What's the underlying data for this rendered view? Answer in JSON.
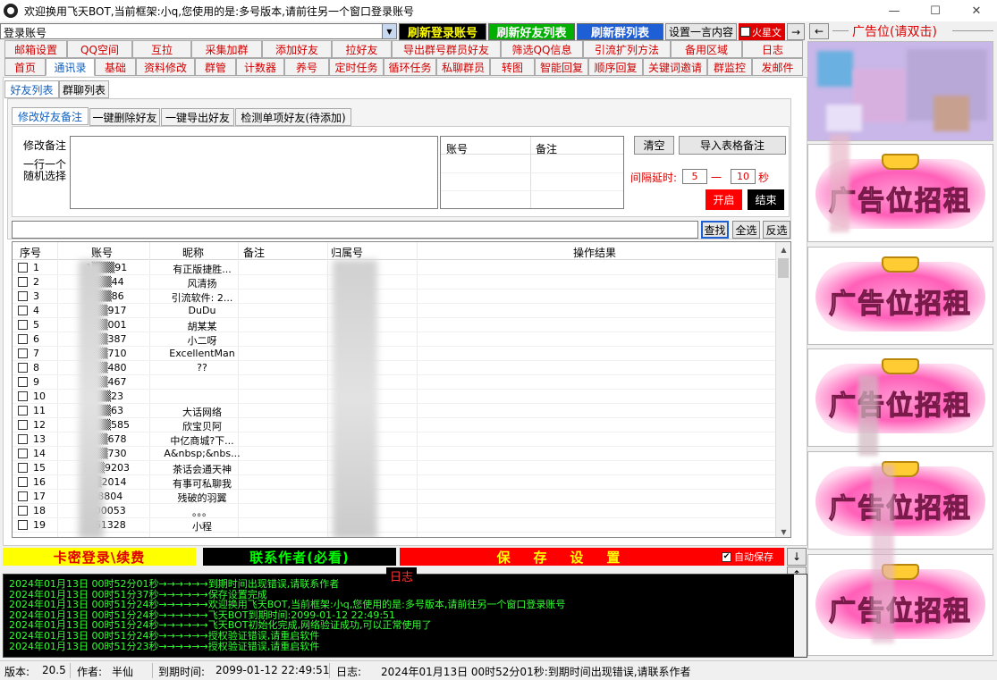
{
  "window": {
    "title": "欢迎换用飞天BOT,当前框架:小q,您使用的是:多号版本,请前往另一个窗口登录账号",
    "controls": [
      "—",
      "☐",
      "✕"
    ]
  },
  "toolbar": {
    "login_label": "登录账号",
    "refresh_login": "刷新登录账号",
    "refresh_friends": "刷新好友列表",
    "refresh_groups": "刷新群列表",
    "set_phrase": "设置一言内容",
    "huoxing": "火星文",
    "arrow_right": "→",
    "arrow_left": "←"
  },
  "menu_row1": [
    "邮箱设置",
    "QQ空间",
    "互拉",
    "采集加群",
    "添加好友",
    "拉好友",
    "导出群号群员好友",
    "筛选QQ信息",
    "引流扩列方法",
    "备用区域",
    "日志"
  ],
  "menu_row2": [
    "首页",
    "通讯录",
    "基础",
    "资料修改",
    "群管",
    "计数器",
    "养号",
    "定时任务",
    "循环任务",
    "私聊群员",
    "转图",
    "智能回复",
    "顺序回复",
    "关键词邀请",
    "群监控",
    "发邮件"
  ],
  "list_tabs": [
    "好友列表",
    "群聊列表"
  ],
  "action_tabs": [
    "修改好友备注",
    "一键删除好友",
    "一键导出好友",
    "检测单项好友(待添加)"
  ],
  "edit": {
    "modify_label": "修改备注",
    "hint_line1": "一行一个",
    "hint_line2": "随机选择",
    "table_head_account": "账号",
    "table_head_note": "备注",
    "clear": "清空",
    "import": "导入表格备注",
    "interval_label": "间隔延时:",
    "interval_from": "5",
    "interval_dash": "一",
    "interval_to": "10",
    "interval_unit": "秒",
    "start": "开启",
    "stop": "结束"
  },
  "search": {
    "value": "",
    "find": "查找",
    "select_all": "全选",
    "invert": "反选"
  },
  "grid": {
    "columns": [
      "序号",
      "账号",
      "昵称",
      "备注",
      "归属号",
      "操作结果"
    ],
    "rows": [
      {
        "seq": "1",
        "account": "1▒▒▒91",
        "nick": "有正版捷胜..."
      },
      {
        "seq": "2",
        "account": "▒▒▒44",
        "nick": "风清扬"
      },
      {
        "seq": "3",
        "account": "▒▒▒86",
        "nick": "引流软件: 2..."
      },
      {
        "seq": "4",
        "account": "2▒▒917",
        "nick": "DuDu"
      },
      {
        "seq": "5",
        "account": "4▒▒001",
        "nick": "胡某某"
      },
      {
        "seq": "6",
        "account": "4▒▒387",
        "nick": "小二呀"
      },
      {
        "seq": "7",
        "account": "5▒▒710",
        "nick": "ExcellentMan"
      },
      {
        "seq": "8",
        "account": "5▒▒480",
        "nick": "??"
      },
      {
        "seq": "9",
        "account": "9▒▒467",
        "nick": ""
      },
      {
        "seq": "10",
        "account": "9▒▒23",
        "nick": ""
      },
      {
        "seq": "11",
        "account": "9▒▒63",
        "nick": "大话网络"
      },
      {
        "seq": "12",
        "account": "14▒▒585",
        "nick": "欣宝贝阿"
      },
      {
        "seq": "13",
        "account": "2▒▒678",
        "nick": "中亿商城?下..."
      },
      {
        "seq": "14",
        "account": "3▒▒730",
        "nick": "A&nbsp;&nbs..."
      },
      {
        "seq": "15",
        "account": "3▒▒9203",
        "nick": "茶话会通天神"
      },
      {
        "seq": "16",
        "account": "▒▒2014",
        "nick": "有事可私聊我"
      },
      {
        "seq": "17",
        "account": "▒8804",
        "nick": "残破的羽翼"
      },
      {
        "seq": "18",
        "account": "▒00053",
        "nick": "。。。"
      },
      {
        "seq": "19",
        "account": "▒61328",
        "nick": "小程"
      }
    ]
  },
  "bottom_bar": {
    "card_login": "卡密登录\\续费",
    "contact": "联系作者(必看)",
    "save": "保    存    设    置",
    "auto_save": "自动保存",
    "down": "↓",
    "up": "↑"
  },
  "log": {
    "title": "日志",
    "lines": [
      "2024年01月13日  00时52分01秒→→→→→→到期时间出现错误,请联系作者",
      "2024年01月13日  00时51分37秒→→→→→→保存设置完成",
      "2024年01月13日  00时51分24秒→→→→→→欢迎换用飞天BOT,当前框架:小q,您使用的是:多号版本,请前往另一个窗口登录账号",
      "2024年01月13日  00时51分24秒→→→→→→飞天BOT到期时间:2099-01-12 22:49:51",
      "2024年01月13日  00时51分24秒→→→→→→飞天BOT初始化完成,网络验证成功,可以正常使用了",
      "2024年01月13日  00时51分24秒→→→→→→授权验证错误,请重启软件",
      "2024年01月13日  00时51分23秒→→→→→→授权验证错误,请重启软件"
    ]
  },
  "status": {
    "version_label": "版本:",
    "version": "20.5",
    "author_label": "作者:",
    "author": "半仙",
    "expiry_label": "到期时间:",
    "expiry": "2099-01-12 22:49:51",
    "log_label": "日志:",
    "log_msg": "2024年01月13日  00时52分01秒:到期时间出现错误,请联系作者"
  },
  "ads": {
    "header": "广告位(请双击)",
    "banner_text": "广告位招租"
  },
  "colors": {
    "yellow": "#ffff00",
    "green": "#00cc00",
    "red": "#ff0000",
    "log_green": "#33ff33",
    "btn_blue": "#1e5fd6",
    "btn_purple": "#c000ff"
  }
}
